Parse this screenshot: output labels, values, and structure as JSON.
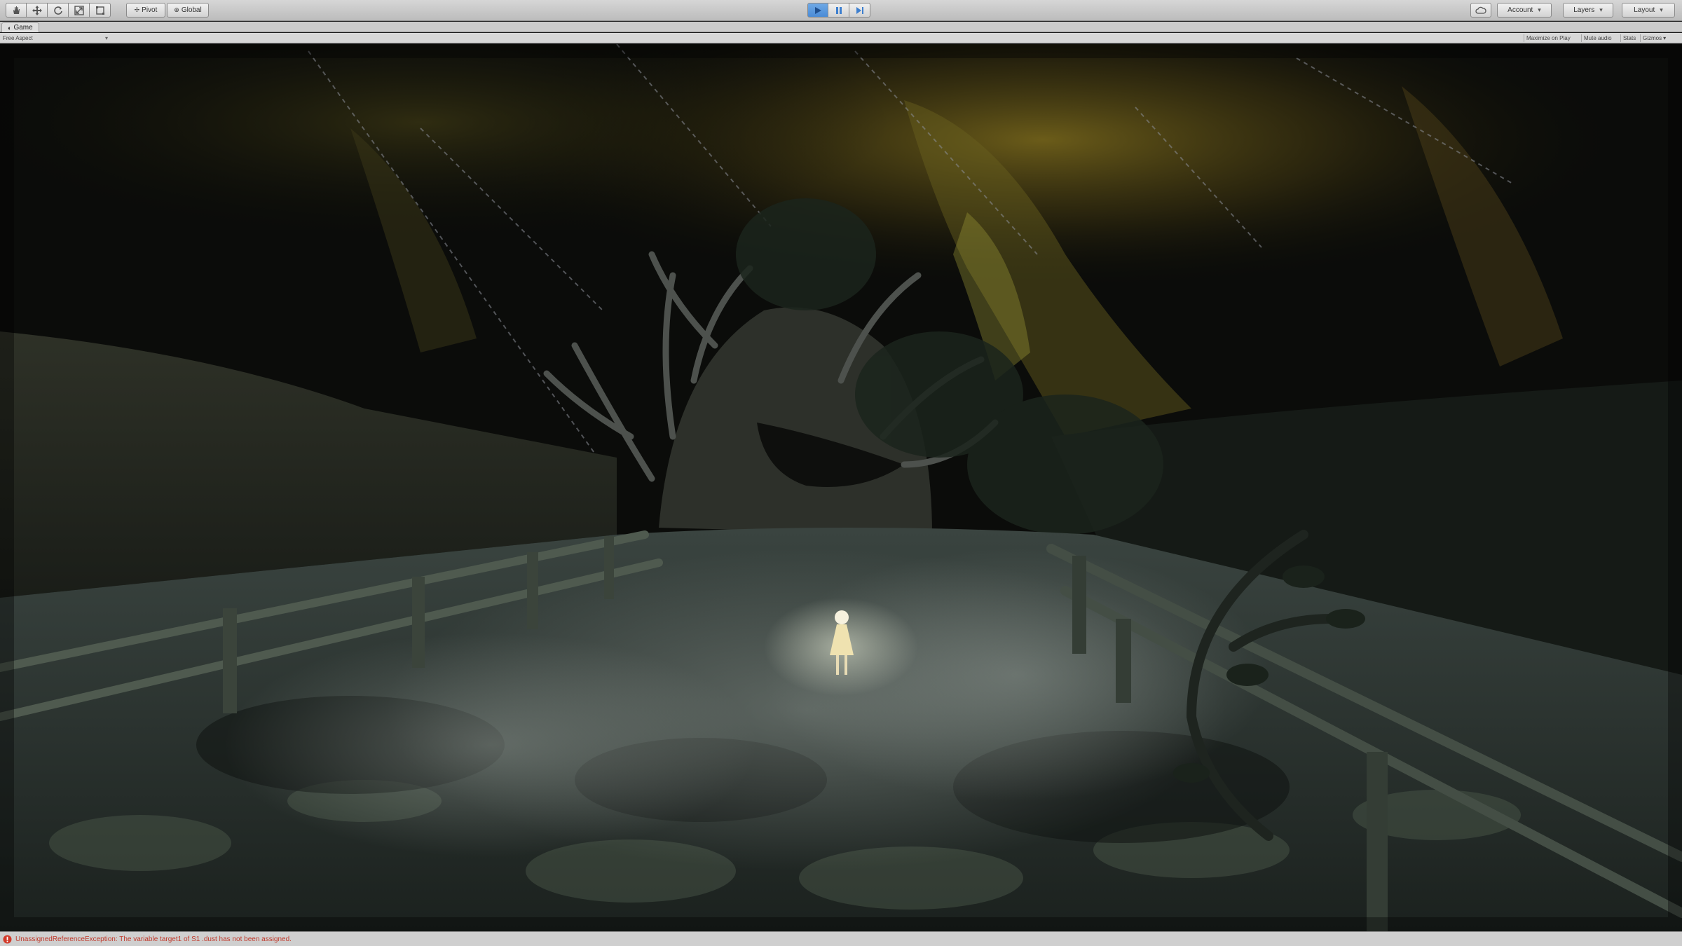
{
  "toolbar": {
    "transform_tools": [
      "hand-icon",
      "move-icon",
      "rotate-icon",
      "scale-icon",
      "rect-icon"
    ],
    "pivot_label": "Pivot",
    "space_label": "Global",
    "play_controls": [
      "play-icon",
      "pause-icon",
      "step-icon"
    ],
    "account_label": "Account",
    "layers_label": "Layers",
    "layout_label": "Layout",
    "accent_color": "#4a8bd6"
  },
  "game_tab": {
    "label": "Game"
  },
  "game_bar": {
    "aspect_label": "Free Aspect",
    "maximize_label": "Maximize on Play",
    "mute_label": "Mute audio",
    "stats_label": "Stats",
    "gizmos_label": "Gizmos"
  },
  "status": {
    "message": "UnassignedReferenceException: The variable target1 of S1 .dust has not been assigned.",
    "icon": "error-icon",
    "color": "#c0392b"
  }
}
